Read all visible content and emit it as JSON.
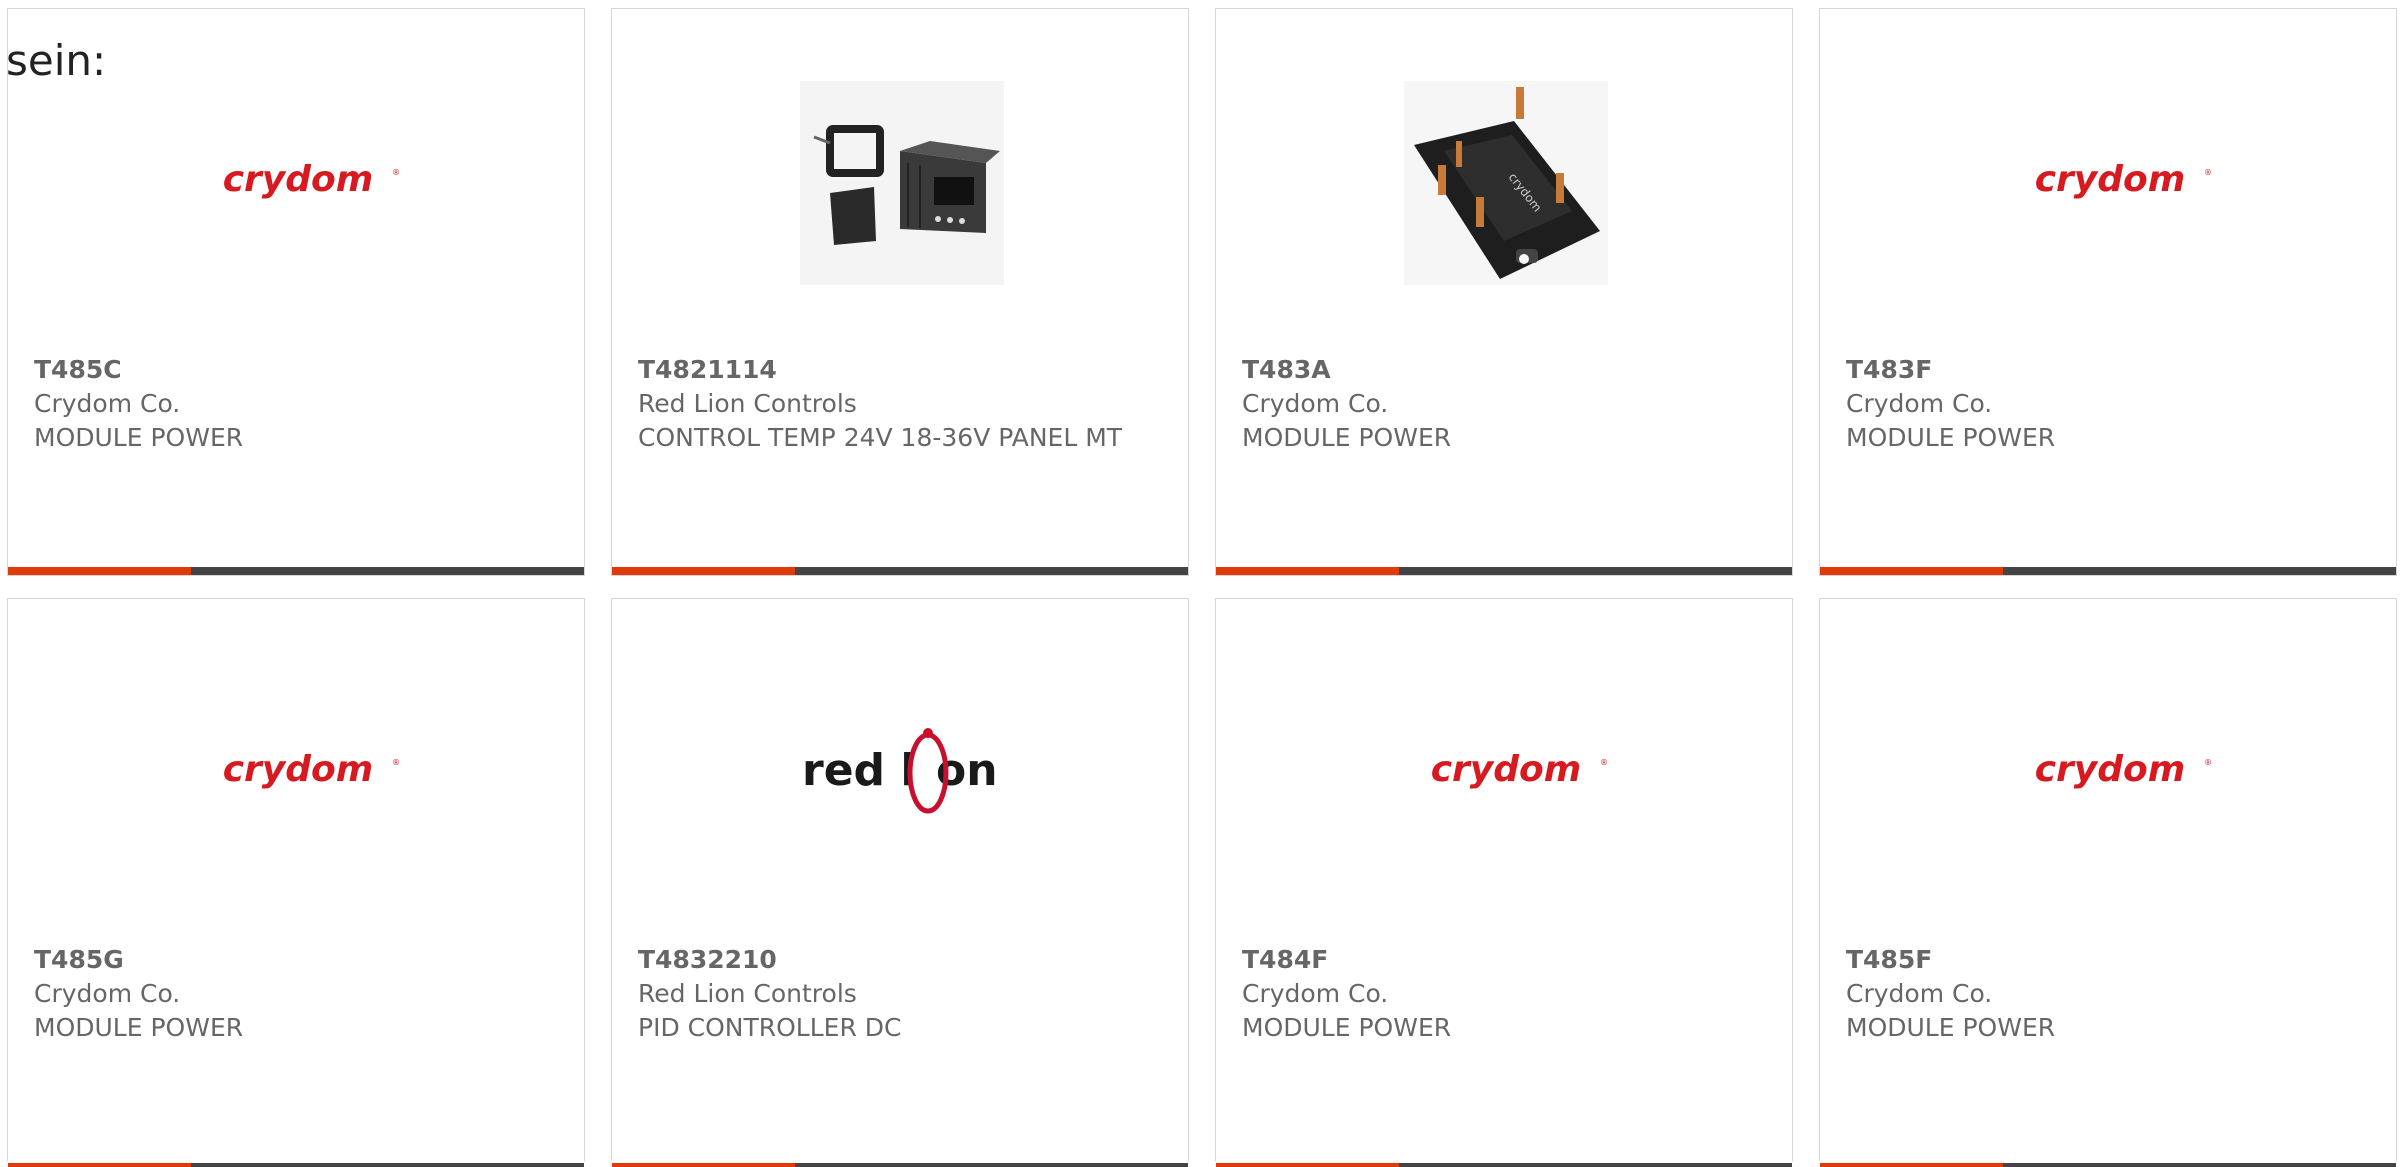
{
  "lead_text": "sein:",
  "colors": {
    "accent": "#e03a0b",
    "bar": "#444444",
    "crydom_red": "#d71920",
    "redlion_red": "#c8102e"
  },
  "products": [
    {
      "part": "T485C",
      "manufacturer": "Crydom Co.",
      "description": "MODULE POWER",
      "image": "crydom-logo"
    },
    {
      "part": "T4821114",
      "manufacturer": "Red Lion Controls",
      "description": "CONTROL TEMP 24V 18-36V PANEL MT",
      "image": "temp-controller-photo"
    },
    {
      "part": "T483A",
      "manufacturer": "Crydom Co.",
      "description": "MODULE POWER",
      "image": "power-module-photo"
    },
    {
      "part": "T483F",
      "manufacturer": "Crydom Co.",
      "description": "MODULE POWER",
      "image": "crydom-logo"
    },
    {
      "part": "T485G",
      "manufacturer": "Crydom Co.",
      "description": "MODULE POWER",
      "image": "crydom-logo"
    },
    {
      "part": "T4832210",
      "manufacturer": "Red Lion Controls",
      "description": "PID CONTROLLER DC",
      "image": "red-lion-logo"
    },
    {
      "part": "T484F",
      "manufacturer": "Crydom Co.",
      "description": "MODULE POWER",
      "image": "crydom-logo"
    },
    {
      "part": "T485F",
      "manufacturer": "Crydom Co.",
      "description": "MODULE POWER",
      "image": "crydom-logo"
    }
  ],
  "logos": {
    "crydom": "crydom",
    "redlion_a": "red l",
    "redlion_b": "on"
  }
}
